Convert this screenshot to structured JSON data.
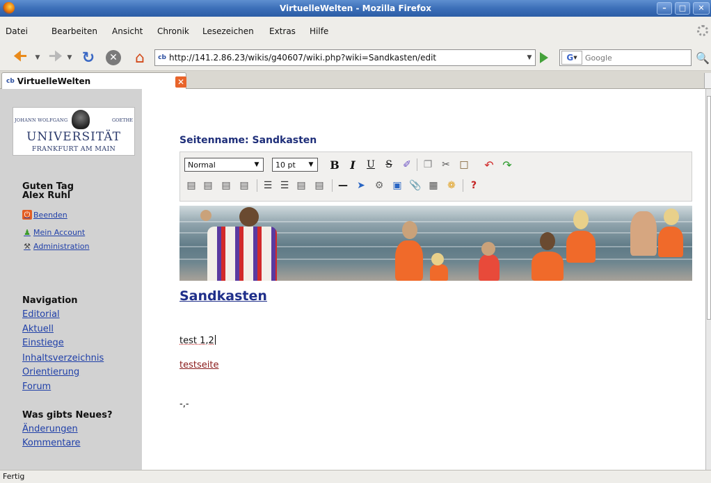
{
  "window": {
    "title": "VirtuelleWelten - Mozilla Firefox"
  },
  "menu": [
    "Datei",
    "Bearbeiten",
    "Ansicht",
    "Chronik",
    "Lesezeichen",
    "Extras",
    "Hilfe"
  ],
  "navbar": {
    "url": "http://141.2.86.23/wikis/g40607/wiki.php?wiki=Sandkasten/edit",
    "search_placeholder": "Google",
    "search_engine": "G",
    "favicon": "cb"
  },
  "tab": {
    "favicon": "cb",
    "label": "VirtuelleWelten"
  },
  "sidebar": {
    "logo": {
      "line1_left": "JOHANN WOLFGANG",
      "line1_right": "GOETHE",
      "line2": "UNIVERSITÄT",
      "line3": "FRANKFURT AM MAIN"
    },
    "greeting_line1": "Guten Tag",
    "greeting_line2": "Alex Ruhl",
    "user_links": [
      "Beenden",
      "Mein Account",
      "Administration"
    ],
    "navigation_title": "Navigation",
    "navigation_links": [
      "Editorial",
      "Aktuell",
      "Einstiege",
      "Inhaltsverzeichnis",
      "Orientierung",
      "Forum"
    ],
    "news_title": "Was gibts Neues?",
    "news_links": [
      "Änderungen",
      "Kommentare"
    ]
  },
  "main": {
    "page_name": "Seitenname: Sandkasten",
    "toolbar": {
      "format_value": "Normal",
      "size_value": "10 pt"
    },
    "heading": "Sandkasten",
    "line1": "test 1,2",
    "link": "testseite",
    "line3": "-,-"
  },
  "status": "Fertig",
  "colors": {
    "titlebar": "#3c6fb8",
    "sidebar": "#d2d2d2",
    "link": "#1f3fa8",
    "heading": "#1f2f8a"
  }
}
